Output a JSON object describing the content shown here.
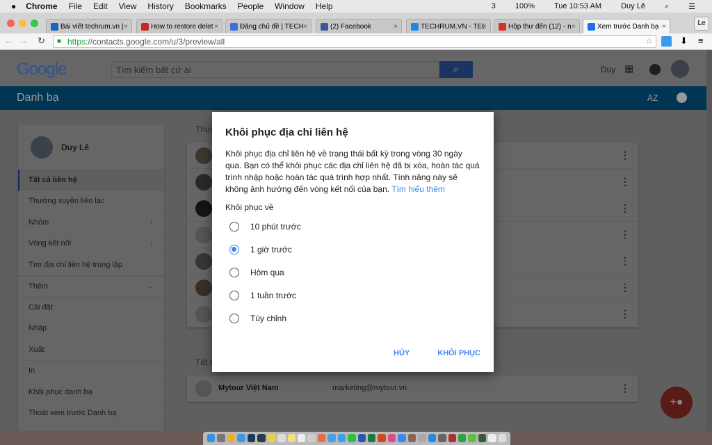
{
  "menubar": {
    "app": "Chrome",
    "items": [
      "File",
      "Edit",
      "View",
      "History",
      "Bookmarks",
      "People",
      "Window",
      "Help"
    ],
    "status": {
      "adobe": "3",
      "battery": "100%",
      "clock": "Tue 10:53 AM",
      "user": "Duy Lê"
    }
  },
  "tabs": [
    {
      "title": "Bài viết techrum.vn |",
      "color": "#1565c0"
    },
    {
      "title": "How to restore delet",
      "color": "#c62828"
    },
    {
      "title": "Đăng chủ đề | TECH",
      "color": "#3f6fd8"
    },
    {
      "title": "(2) Facebook",
      "color": "#3b5998"
    },
    {
      "title": "TECHRUM.VN - TEC",
      "color": "#1e88e5"
    },
    {
      "title": "Hộp thư đến (12) - n",
      "color": "#d93025"
    },
    {
      "title": "Xem trước Danh bạ G",
      "color": "#1a73e8",
      "active": true
    }
  ],
  "profile_button": "Le",
  "address": {
    "scheme": "https",
    "url": "://contacts.google.com/u/3/preview/all"
  },
  "header": {
    "logo": "Google",
    "search_placeholder": "Tìm kiếm bất cứ ai",
    "user": "Duy"
  },
  "appbar": {
    "title": "Danh bạ",
    "sort_icon": "AZ"
  },
  "sidebar": {
    "user": "Duy Lê",
    "items": [
      {
        "label": "Tất cả liên hệ",
        "active": true
      },
      {
        "label": "Thường xuyên liên lạc"
      },
      {
        "label": "Nhóm",
        "chevron": "›"
      },
      {
        "label": "Vòng kết nối",
        "chevron": "›"
      },
      {
        "label": "Tìm địa chỉ liên hệ trùng lặp"
      },
      {
        "label": "Thêm",
        "chevron": "⌄"
      },
      {
        "label": "Cài đặt"
      },
      {
        "label": "Nhập"
      },
      {
        "label": "Xuất"
      },
      {
        "label": "In"
      },
      {
        "label": "Khôi phục danh bạ"
      },
      {
        "label": "Thoát xem trước Danh bạ"
      }
    ]
  },
  "sections": {
    "frequent": "Thường xuyên liên lạc",
    "all": "Tất cả liên hệ"
  },
  "contacts": [
    {
      "name": "Mytour Việt Nam",
      "email": "marketing@mytour.vn"
    }
  ],
  "dialog": {
    "title": "Khôi phục địa chỉ liên hệ",
    "description": "Khôi phục địa chỉ liên hệ về trạng thái bất kỳ trong vòng 30 ngày qua. Bạn có thể khôi phục các địa chỉ liên hệ đã bị xóa, hoàn tác quá trình nhập hoặc hoàn tác quá trình hợp nhất. Tính năng này sẽ không ảnh hưởng đến vòng kết nối của bạn.",
    "learn_more": "Tìm hiểu thêm",
    "restore_to": "Khôi phục về",
    "options": [
      "10 phút trước",
      "1 giờ trước",
      "Hôm qua",
      "1 tuần trước",
      "Tùy chỉnh"
    ],
    "selected": "1 giờ trước",
    "cancel": "HỦY",
    "confirm": "KHÔI PHỤC"
  },
  "colors": {
    "accent": "#4285f4",
    "appbar": "#0288d1",
    "fab": "#db4437"
  }
}
